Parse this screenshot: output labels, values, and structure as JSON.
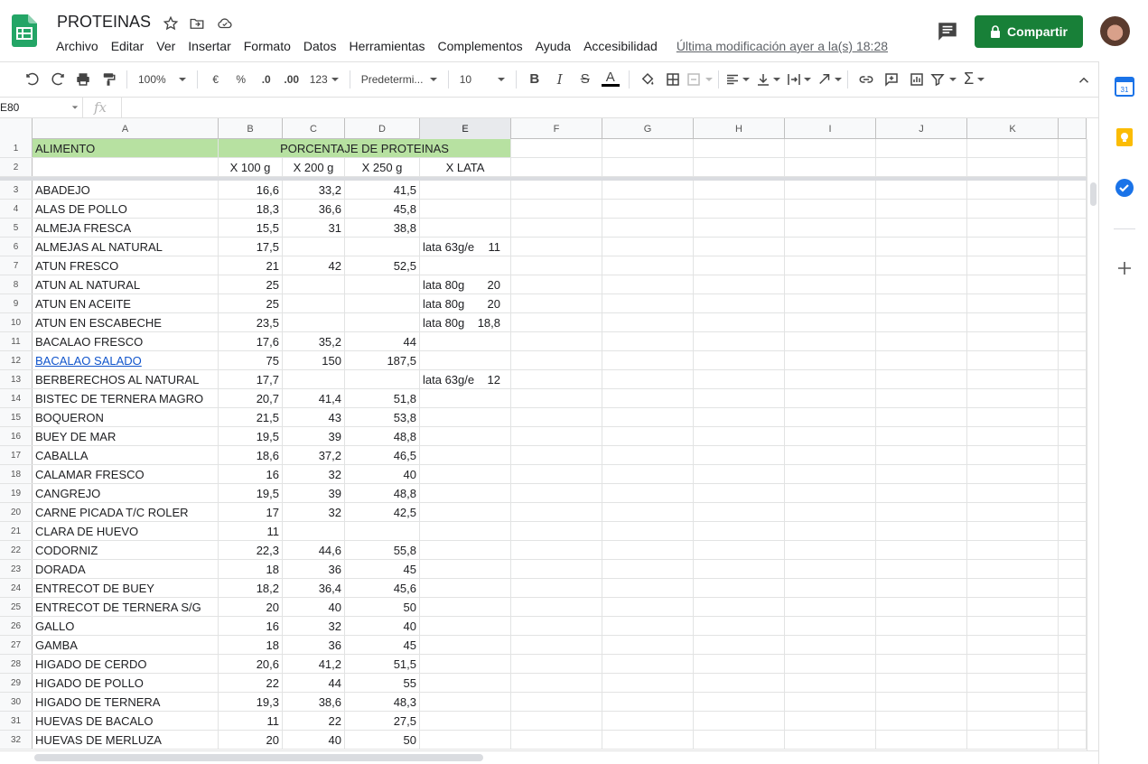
{
  "header": {
    "title": "PROTEINAS",
    "last_edit": "Última modificación ayer a la(s) 18:28",
    "share_label": "Compartir",
    "menus": [
      "Archivo",
      "Editar",
      "Ver",
      "Insertar",
      "Formato",
      "Datos",
      "Herramientas",
      "Complementos",
      "Ayuda",
      "Accesibilidad"
    ],
    "brand_color": "#188038"
  },
  "toolbar": {
    "zoom": "100%",
    "currency": "€",
    "percent": "%",
    "dec_decrease": ".0",
    "dec_increase": ".00",
    "more_formats": "123",
    "font": "Predetermi...",
    "font_size": "10",
    "bold": "B",
    "italic": "I",
    "strike": "S",
    "text_color": "A"
  },
  "formula_bar": {
    "cell_ref": "E80",
    "fx": "fx"
  },
  "grid": {
    "columns": [
      "A",
      "B",
      "C",
      "D",
      "E",
      "F",
      "G",
      "H",
      "I",
      "J",
      "K"
    ],
    "selected_column": "E",
    "header_row": {
      "num": "1",
      "a": "ALIMENTO",
      "merged_bcde": "PORCENTAJE DE PROTEINAS"
    },
    "sub_header_row": {
      "num": "2",
      "b": "X 100 g",
      "c": "X 200 g",
      "d": "X 250 g",
      "e": "X LATA"
    },
    "rows": [
      {
        "num": "3",
        "a": "ABADEJO",
        "b": "16,6",
        "c": "33,2",
        "d": "41,5",
        "e1": "",
        "e2": ""
      },
      {
        "num": "4",
        "a": "ALAS DE POLLO",
        "b": "18,3",
        "c": "36,6",
        "d": "45,8",
        "e1": "",
        "e2": ""
      },
      {
        "num": "5",
        "a": "ALMEJA FRESCA",
        "b": "15,5",
        "c": "31",
        "d": "38,8",
        "e1": "",
        "e2": ""
      },
      {
        "num": "6",
        "a": "ALMEJAS AL NATURAL",
        "b": "17,5",
        "c": "",
        "d": "",
        "e1": "lata 63g/e",
        "e2": "11"
      },
      {
        "num": "7",
        "a": "ATUN  FRESCO",
        "b": "21",
        "c": "42",
        "d": "52,5",
        "e1": "",
        "e2": ""
      },
      {
        "num": "8",
        "a": "ATUN AL NATURAL",
        "b": "25",
        "c": "",
        "d": "",
        "e1": "lata 80g",
        "e2": "20"
      },
      {
        "num": "9",
        "a": "ATUN EN ACEITE",
        "b": "25",
        "c": "",
        "d": "",
        "e1": "lata 80g",
        "e2": "20"
      },
      {
        "num": "10",
        "a": "ATUN EN ESCABECHE",
        "b": "23,5",
        "c": "",
        "d": "",
        "e1": "lata 80g",
        "e2": "18,8"
      },
      {
        "num": "11",
        "a": "BACALAO FRESCO",
        "b": "17,6",
        "c": "35,2",
        "d": "44",
        "e1": "",
        "e2": ""
      },
      {
        "num": "12",
        "a": "BACALAO SALADO ",
        "b": "75",
        "c": "150",
        "d": "187,5",
        "e1": "",
        "e2": "",
        "link": true
      },
      {
        "num": "13",
        "a": "BERBERECHOS AL NATURAL",
        "b": "17,7",
        "c": "",
        "d": "",
        "e1": "lata 63g/e",
        "e2": "12"
      },
      {
        "num": "14",
        "a": "BISTEC DE TERNERA MAGRO",
        "b": "20,7",
        "c": "41,4",
        "d": "51,8",
        "e1": "",
        "e2": ""
      },
      {
        "num": "15",
        "a": "BOQUERON",
        "b": "21,5",
        "c": "43",
        "d": "53,8",
        "e1": "",
        "e2": ""
      },
      {
        "num": "16",
        "a": "BUEY DE MAR",
        "b": "19,5",
        "c": "39",
        "d": "48,8",
        "e1": "",
        "e2": ""
      },
      {
        "num": "17",
        "a": "CABALLA",
        "b": "18,6",
        "c": "37,2",
        "d": "46,5",
        "e1": "",
        "e2": ""
      },
      {
        "num": "18",
        "a": "CALAMAR FRESCO",
        "b": "16",
        "c": "32",
        "d": "40",
        "e1": "",
        "e2": ""
      },
      {
        "num": "19",
        "a": "CANGREJO",
        "b": "19,5",
        "c": "39",
        "d": "48,8",
        "e1": "",
        "e2": ""
      },
      {
        "num": "20",
        "a": "CARNE PICADA T/C ROLER",
        "b": "17",
        "c": "32",
        "d": "42,5",
        "e1": "",
        "e2": ""
      },
      {
        "num": "21",
        "a": "CLARA DE HUEVO",
        "b": "11",
        "c": "",
        "d": "",
        "e1": "",
        "e2": ""
      },
      {
        "num": "22",
        "a": "CODORNIZ",
        "b": "22,3",
        "c": "44,6",
        "d": "55,8",
        "e1": "",
        "e2": ""
      },
      {
        "num": "23",
        "a": "DORADA",
        "b": "18",
        "c": "36",
        "d": "45",
        "e1": "",
        "e2": ""
      },
      {
        "num": "24",
        "a": "ENTRECOT DE BUEY",
        "b": "18,2",
        "c": "36,4",
        "d": "45,6",
        "e1": "",
        "e2": ""
      },
      {
        "num": "25",
        "a": "ENTRECOT DE TERNERA  S/G",
        "b": "20",
        "c": "40",
        "d": "50",
        "e1": "",
        "e2": ""
      },
      {
        "num": "26",
        "a": "GALLO",
        "b": "16",
        "c": "32",
        "d": "40",
        "e1": "",
        "e2": ""
      },
      {
        "num": "27",
        "a": "GAMBA",
        "b": "18",
        "c": "36",
        "d": "45",
        "e1": "",
        "e2": ""
      },
      {
        "num": "28",
        "a": "HIGADO DE CERDO",
        "b": "20,6",
        "c": "41,2",
        "d": "51,5",
        "e1": "",
        "e2": ""
      },
      {
        "num": "29",
        "a": "HIGADO DE POLLO",
        "b": "22",
        "c": "44",
        "d": "55",
        "e1": "",
        "e2": ""
      },
      {
        "num": "30",
        "a": "HIGADO DE TERNERA",
        "b": "19,3",
        "c": "38,6",
        "d": "48,3",
        "e1": "",
        "e2": ""
      },
      {
        "num": "31",
        "a": "HUEVAS DE BACALO",
        "b": "11",
        "c": "22",
        "d": "27,5",
        "e1": "",
        "e2": ""
      },
      {
        "num": "32",
        "a": "HUEVAS DE MERLUZA",
        "b": "20",
        "c": "40",
        "d": "50",
        "e1": "",
        "e2": ""
      }
    ]
  },
  "side_panel": {
    "calendar_day": "31",
    "icons": [
      "calendar-icon",
      "keep-icon",
      "tasks-icon",
      "add-icon"
    ]
  }
}
